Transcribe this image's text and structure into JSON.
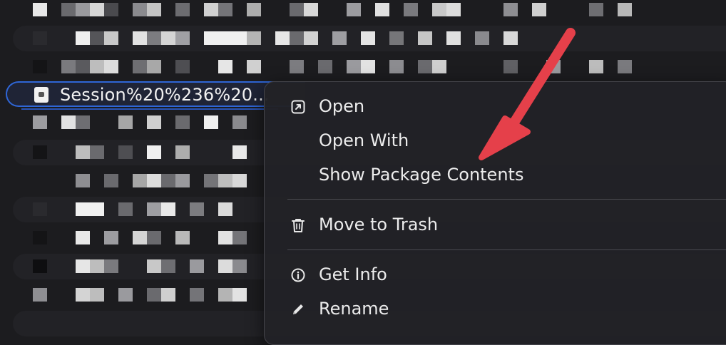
{
  "file_list": {
    "selected_file_name": "Session%20%236%20..."
  },
  "context_menu": {
    "items": [
      {
        "label": "Open",
        "icon": "open-arrow-icon"
      },
      {
        "label": "Open With",
        "icon": ""
      },
      {
        "label": "Show Package Contents",
        "icon": ""
      },
      {
        "label": "Move to Trash",
        "icon": "trash-icon"
      },
      {
        "label": "Get Info",
        "icon": "info-icon"
      },
      {
        "label": "Rename",
        "icon": "pencil-icon"
      }
    ]
  },
  "annotation": {
    "arrow_color": "#e5404a",
    "points_to": "Show Package Contents"
  },
  "colors": {
    "selection_border": "#2f66d6",
    "menu_background": "#222226",
    "text": "#ececec"
  }
}
